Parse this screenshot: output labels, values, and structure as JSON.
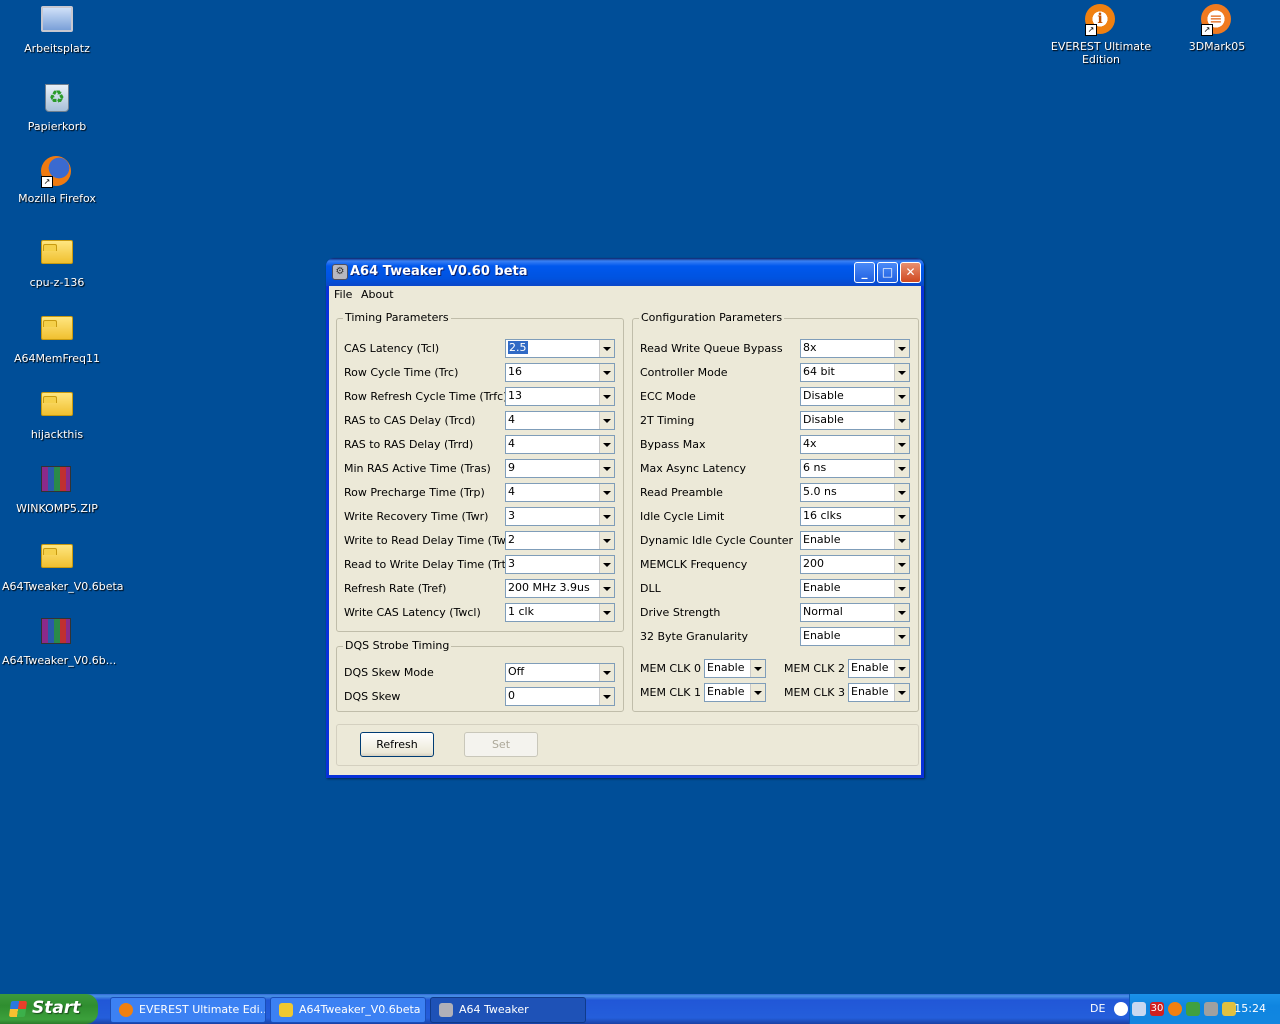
{
  "desktop": {
    "icons_left": [
      {
        "label": "Arbeitsplatz",
        "icon": "computer-icon"
      },
      {
        "label": "Papierkorb",
        "icon": "recycle-bin-icon"
      },
      {
        "label": "Mozilla Firefox",
        "icon": "firefox-icon"
      },
      {
        "label": "cpu-z-136",
        "icon": "folder-icon"
      },
      {
        "label": "A64MemFreq11",
        "icon": "folder-icon"
      },
      {
        "label": "hijackthis",
        "icon": "folder-icon"
      },
      {
        "label": "WINKOMP5.ZIP",
        "icon": "zip-archive-icon"
      },
      {
        "label": "A64Tweaker_V0.6beta",
        "icon": "folder-icon"
      },
      {
        "label": "A64Tweaker_V0.6b...",
        "icon": "zip-archive-icon"
      }
    ],
    "icons_right": [
      {
        "label": "EVEREST Ultimate Edition",
        "icon": "everest-icon"
      },
      {
        "label": "3DMark05",
        "icon": "3dmark-icon"
      }
    ]
  },
  "window": {
    "title": "A64 Tweaker V0.60 beta",
    "menu": [
      "File",
      "About"
    ],
    "timing": {
      "title": "Timing Parameters",
      "rows": [
        {
          "label": "CAS Latency (Tcl)",
          "value": "2.5"
        },
        {
          "label": "Row Cycle Time (Trc)",
          "value": "16"
        },
        {
          "label": "Row Refresh Cycle Time (Trfc)",
          "value": "13"
        },
        {
          "label": "RAS to CAS Delay (Trcd)",
          "value": "4"
        },
        {
          "label": "RAS to RAS Delay (Trrd)",
          "value": "4"
        },
        {
          "label": "Min RAS Active Time (Tras)",
          "value": "9"
        },
        {
          "label": "Row Precharge Time (Trp)",
          "value": "4"
        },
        {
          "label": "Write Recovery Time (Twr)",
          "value": "3"
        },
        {
          "label": "Write to Read Delay Time (Twtr)",
          "value": "2"
        },
        {
          "label": "Read to Write Delay Time (Trtw)",
          "value": "3"
        },
        {
          "label": "Refresh Rate (Tref)",
          "value": "200 MHz 3.9us"
        },
        {
          "label": "Write CAS Latency (Twcl)",
          "value": "1 clk"
        }
      ]
    },
    "dqs": {
      "title": "DQS Strobe Timing",
      "rows": [
        {
          "label": "DQS Skew Mode",
          "value": "Off"
        },
        {
          "label": "DQS Skew",
          "value": "0"
        }
      ]
    },
    "config": {
      "title": "Configuration Parameters",
      "rows": [
        {
          "label": "Read Write Queue Bypass",
          "value": "8x"
        },
        {
          "label": "Controller Mode",
          "value": "64 bit"
        },
        {
          "label": "ECC Mode",
          "value": "Disable"
        },
        {
          "label": "2T Timing",
          "value": "Disable"
        },
        {
          "label": "Bypass Max",
          "value": "4x"
        },
        {
          "label": "Max Async Latency",
          "value": "6 ns"
        },
        {
          "label": "Read Preamble",
          "value": "5.0 ns"
        },
        {
          "label": "Idle Cycle Limit",
          "value": "16 clks"
        },
        {
          "label": "Dynamic Idle Cycle Counter",
          "value": "Enable"
        },
        {
          "label": "MEMCLK Frequency",
          "value": "200"
        },
        {
          "label": "DLL",
          "value": "Enable"
        },
        {
          "label": "Drive Strength",
          "value": "Normal"
        },
        {
          "label": "32 Byte Granularity",
          "value": "Enable"
        }
      ],
      "memclk": [
        {
          "label": "MEM CLK 0",
          "value": "Enable"
        },
        {
          "label": "MEM CLK 2",
          "value": "Enable"
        },
        {
          "label": "MEM CLK 1",
          "value": "Enable"
        },
        {
          "label": "MEM CLK 3",
          "value": "Enable"
        }
      ]
    },
    "buttons": {
      "refresh": "Refresh",
      "set": "Set"
    }
  },
  "taskbar": {
    "start": "Start",
    "tasks": [
      "EVEREST Ultimate Edi...",
      "A64Tweaker_V0.6beta",
      "A64 Tweaker"
    ],
    "lang": "DE",
    "tray_badge": "30",
    "clock": "15:24"
  }
}
